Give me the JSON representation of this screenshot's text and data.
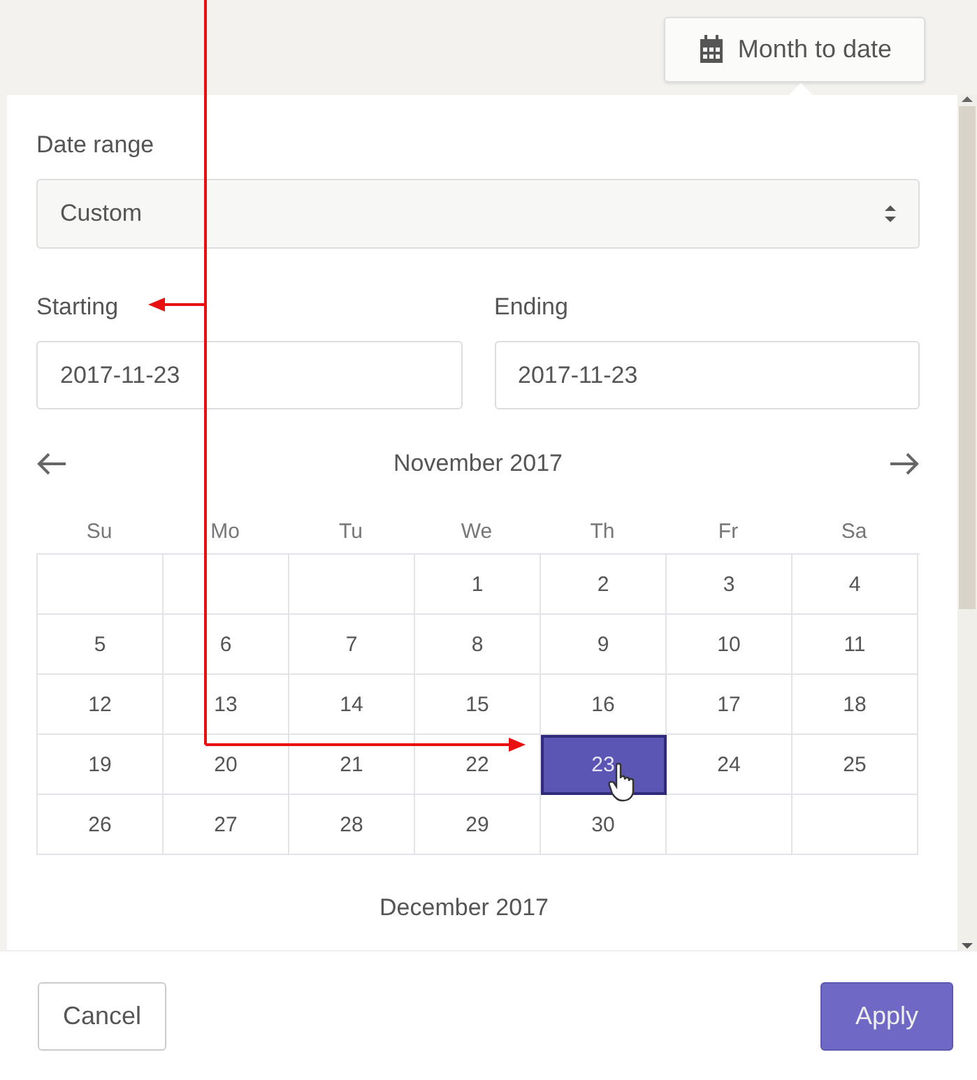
{
  "top_button": {
    "label": "Month to date"
  },
  "date_range": {
    "label": "Date range",
    "value": "Custom"
  },
  "starting": {
    "label": "Starting",
    "value": "2017-11-23"
  },
  "ending": {
    "label": "Ending",
    "value": "2017-11-23"
  },
  "calendar": {
    "month": "November 2017",
    "weekdays": [
      "Su",
      "Mo",
      "Tu",
      "We",
      "Th",
      "Fr",
      "Sa"
    ],
    "cells": [
      {
        "kind": "blank"
      },
      {
        "kind": "blank"
      },
      {
        "kind": "blank"
      },
      {
        "kind": "day",
        "day": "1",
        "selected": false
      },
      {
        "kind": "day",
        "day": "2",
        "selected": false
      },
      {
        "kind": "day",
        "day": "3",
        "selected": false
      },
      {
        "kind": "day",
        "day": "4",
        "selected": false
      },
      {
        "kind": "day",
        "day": "5",
        "selected": false
      },
      {
        "kind": "day",
        "day": "6",
        "selected": false
      },
      {
        "kind": "day",
        "day": "7",
        "selected": false
      },
      {
        "kind": "day",
        "day": "8",
        "selected": false
      },
      {
        "kind": "day",
        "day": "9",
        "selected": false
      },
      {
        "kind": "day",
        "day": "10",
        "selected": false
      },
      {
        "kind": "day",
        "day": "11",
        "selected": false
      },
      {
        "kind": "day",
        "day": "12",
        "selected": false
      },
      {
        "kind": "day",
        "day": "13",
        "selected": false
      },
      {
        "kind": "day",
        "day": "14",
        "selected": false
      },
      {
        "kind": "day",
        "day": "15",
        "selected": false
      },
      {
        "kind": "day",
        "day": "16",
        "selected": false
      },
      {
        "kind": "day",
        "day": "17",
        "selected": false
      },
      {
        "kind": "day",
        "day": "18",
        "selected": false
      },
      {
        "kind": "day",
        "day": "19",
        "selected": false
      },
      {
        "kind": "day",
        "day": "20",
        "selected": false
      },
      {
        "kind": "day",
        "day": "21",
        "selected": false
      },
      {
        "kind": "day",
        "day": "22",
        "selected": false
      },
      {
        "kind": "day",
        "day": "23",
        "selected": true
      },
      {
        "kind": "day",
        "day": "24",
        "selected": false
      },
      {
        "kind": "day",
        "day": "25",
        "selected": false
      },
      {
        "kind": "day",
        "day": "26",
        "selected": false
      },
      {
        "kind": "day",
        "day": "27",
        "selected": false
      },
      {
        "kind": "day",
        "day": "28",
        "selected": false
      },
      {
        "kind": "day",
        "day": "29",
        "selected": false
      },
      {
        "kind": "day",
        "day": "30",
        "selected": false
      },
      {
        "kind": "blank"
      },
      {
        "kind": "blank"
      }
    ]
  },
  "next_month": "December 2017",
  "buttons": [
    {
      "label": "Cancel",
      "kind": "secondary"
    },
    {
      "label": "Apply",
      "kind": "primary"
    }
  ]
}
